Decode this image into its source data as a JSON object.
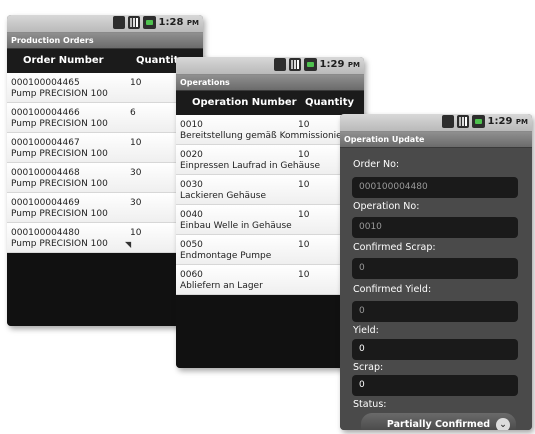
{
  "status_icons": [
    "3g-icon",
    "signal-icon",
    "battery-icon"
  ],
  "production": {
    "time": "1:28",
    "ampm": "PM",
    "title": "Production Orders",
    "col_order": "Order Number",
    "col_qty": "Quantity",
    "rows": [
      {
        "number": "000100004465",
        "product": "Pump PRECISION 100",
        "qty": "10"
      },
      {
        "number": "000100004466",
        "product": "Pump PRECISION 100",
        "qty": "6"
      },
      {
        "number": "000100004467",
        "product": "Pump PRECISION 100",
        "qty": "10"
      },
      {
        "number": "000100004468",
        "product": "Pump PRECISION 100",
        "qty": "30"
      },
      {
        "number": "000100004469",
        "product": "Pump PRECISION 100",
        "qty": "30"
      },
      {
        "number": "000100004480",
        "product": "Pump PRECISION 100",
        "qty": "10"
      }
    ]
  },
  "operations": {
    "time": "1:29",
    "ampm": "PM",
    "title": "Operations",
    "col_op": "Operation Number",
    "col_qty": "Quantity",
    "rows": [
      {
        "number": "0010",
        "desc": "Bereitstellung gemäß Kommissionier",
        "qty": "10"
      },
      {
        "number": "0020",
        "desc": "Einpressen Laufrad in Gehäuse",
        "qty": "10"
      },
      {
        "number": "0030",
        "desc": "Lackieren Gehäuse",
        "qty": "10"
      },
      {
        "number": "0040",
        "desc": "Einbau Welle in Gehäuse",
        "qty": "10"
      },
      {
        "number": "0050",
        "desc": "Endmontage Pumpe",
        "qty": "10"
      },
      {
        "number": "0060",
        "desc": "Abliefern an Lager",
        "qty": "10"
      }
    ]
  },
  "update": {
    "time": "1:29",
    "ampm": "PM",
    "title": "Operation Update",
    "order_label": "Order No:",
    "order_value": "000100004480",
    "op_label": "Operation No:",
    "op_value": "0010",
    "conf_scrap_label": "Confirmed Scrap:",
    "conf_scrap_value": "0",
    "conf_yield_label": "Confirmed Yield:",
    "conf_yield_value": "0",
    "yield_label": "Yield:",
    "yield_value": "0",
    "scrap_label": "Scrap:",
    "scrap_value": "0",
    "status_label": "Status:",
    "status_value": "Partially Confirmed"
  }
}
